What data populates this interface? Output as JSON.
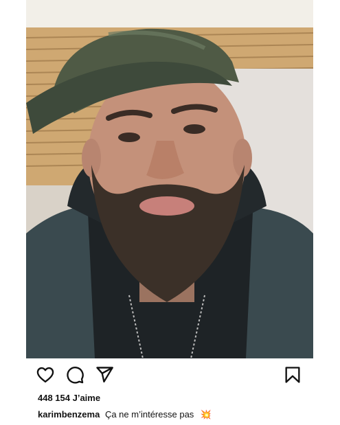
{
  "post": {
    "likes_text": "448 154 J’aime",
    "username": "karimbenzema",
    "caption_text": "Ça ne m’intéresse pas",
    "caption_emoji": "💥"
  },
  "icons": {
    "like": "heart-icon",
    "comment": "comment-icon",
    "share": "send-icon",
    "save": "bookmark-icon"
  },
  "colors": {
    "text": "#111111",
    "background": "#ffffff",
    "emoji": "#e0572a"
  }
}
